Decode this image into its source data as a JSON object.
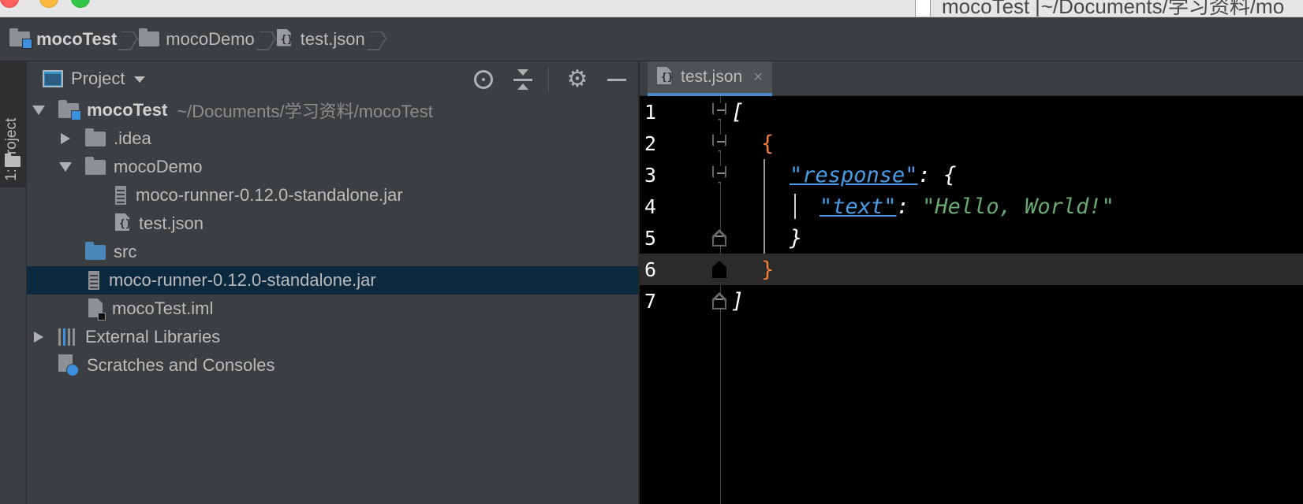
{
  "window": {
    "title": "mocoTest [~/Documents/学习资料/mo"
  },
  "breadcrumb": {
    "items": [
      "mocoTest",
      "mocoDemo",
      "test.json"
    ]
  },
  "toolstrip": {
    "project_label": "1: Project"
  },
  "project_panel": {
    "title": "Project",
    "tree": [
      {
        "label": "mocoTest",
        "path": "~/Documents/学习资料/mocoTest"
      },
      {
        "label": ".idea"
      },
      {
        "label": "mocoDemo"
      },
      {
        "label": "moco-runner-0.12.0-standalone.jar"
      },
      {
        "label": "test.json"
      },
      {
        "label": "src"
      },
      {
        "label": "moco-runner-0.12.0-standalone.jar"
      },
      {
        "label": "mocoTest.iml"
      },
      {
        "label": "External Libraries"
      },
      {
        "label": "Scratches and Consoles"
      }
    ]
  },
  "editor": {
    "tab": "test.json",
    "tab_close": "×",
    "lines": [
      "1",
      "2",
      "3",
      "4",
      "5",
      "6",
      "7"
    ],
    "code": {
      "l1": "[",
      "l2": "{",
      "l3_key": "\"response\"",
      "l3_rest": ": {",
      "l4_key": "\"text\"",
      "l4_colon": ": ",
      "l4_val": "\"Hello, World!\"",
      "l5": "}",
      "l6": "}",
      "l7": "]"
    }
  },
  "icons": {
    "settings": "gear-icon",
    "locate": "locate-icon",
    "collapse": "collapse-all-icon",
    "hide": "minimize-icon"
  },
  "colors": {
    "editor_bg": "#000000",
    "panel_bg": "#3c3f41",
    "selection": "#0d293e",
    "json_key": "#4a9ce6",
    "json_string": "#6aab73",
    "brace_highlight": "#f07d3c"
  }
}
